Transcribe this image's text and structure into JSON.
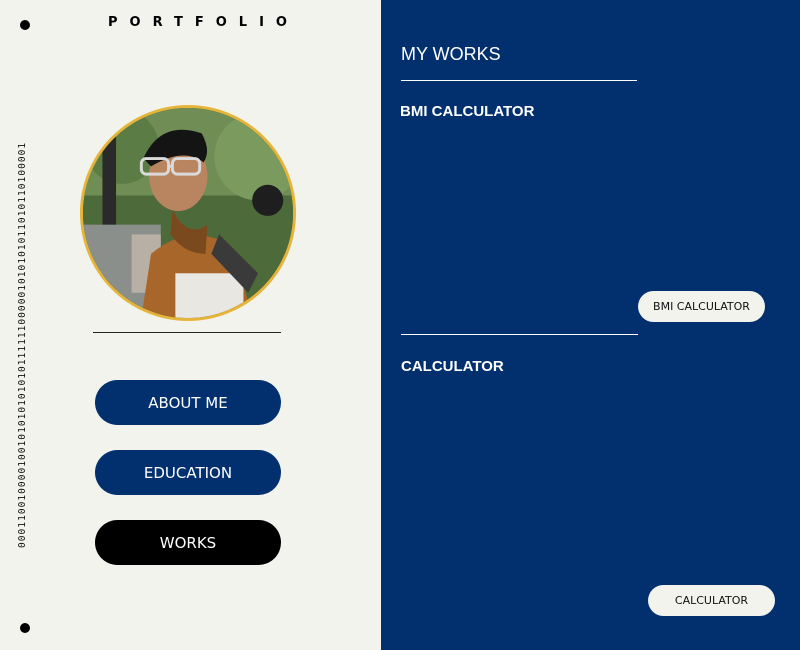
{
  "brand": "PORTFOLIO",
  "binary_strip": "000110010000100101010101010111111000001010101011010110100001",
  "avatar_alt": "profile photo",
  "nav": {
    "about": "ABOUT ME",
    "education": "EDUCATION",
    "works": "WORKS"
  },
  "works": {
    "title": "MY WORKS",
    "projects": [
      {
        "title": "BMI CALCULATOR",
        "button": "BMI CALCULATOR"
      },
      {
        "title": "CALCULATOR",
        "button": "CALCULATOR"
      }
    ]
  },
  "colors": {
    "navy": "#02306f",
    "cream": "#f3f3ee",
    "black": "#000000",
    "gold_ring": "#e4b53a"
  }
}
